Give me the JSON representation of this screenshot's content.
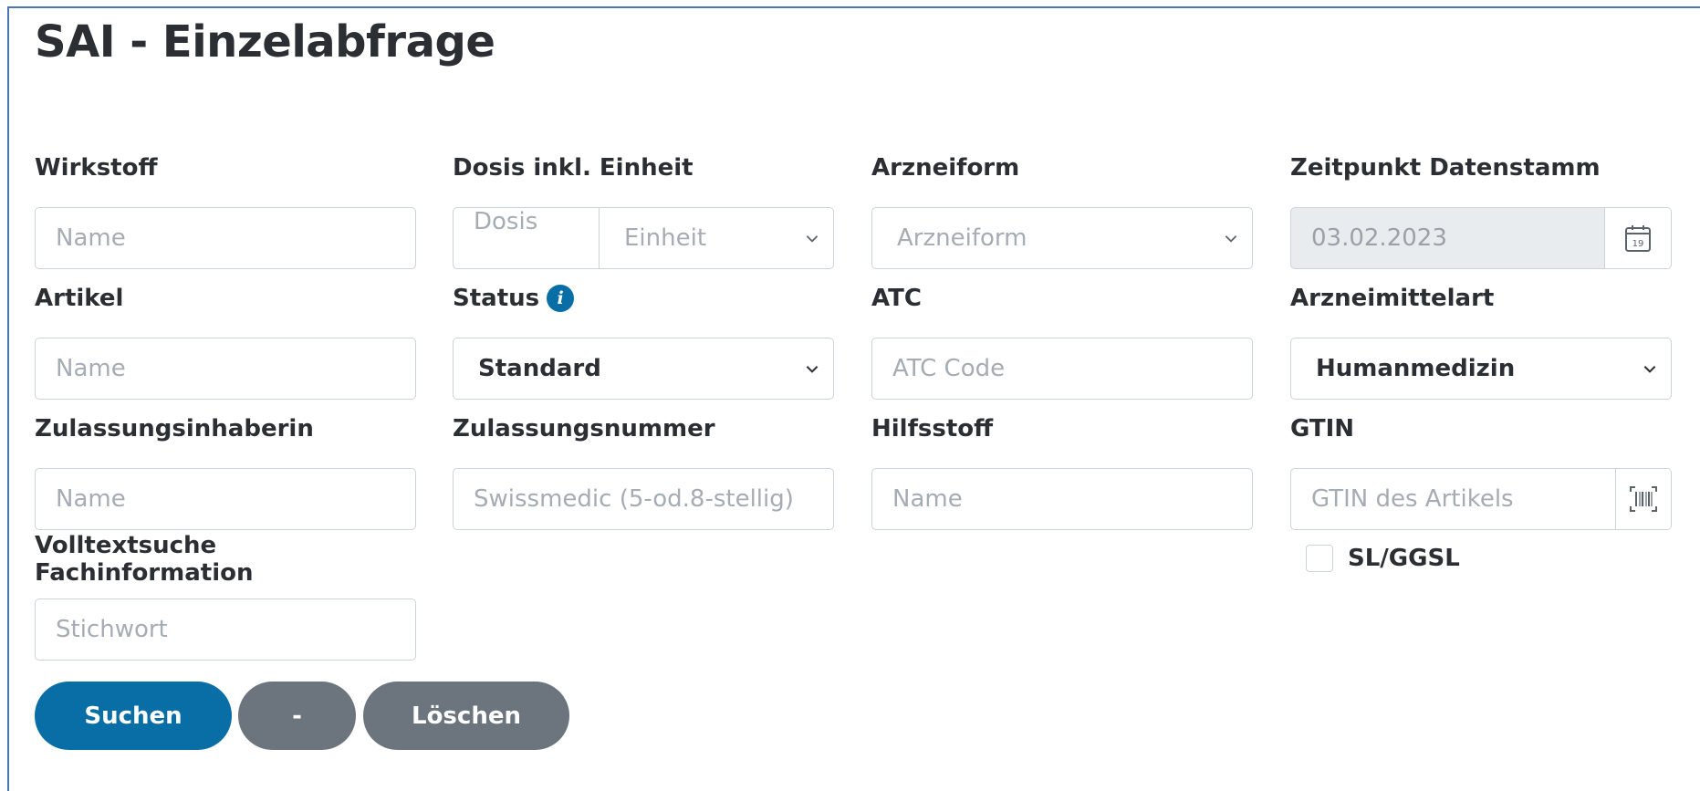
{
  "title": "SAI - Einzelabfrage",
  "fields": {
    "wirkstoff": {
      "label": "Wirkstoff",
      "placeholder": "Name",
      "value": ""
    },
    "dosis": {
      "label": "Dosis inkl. Einheit",
      "dosis_placeholder": "Dosis",
      "einheit_placeholder": "Einheit"
    },
    "arzneiform": {
      "label": "Arzneiform",
      "placeholder": "Arzneiform"
    },
    "zeitpunkt": {
      "label": "Zeitpunkt Datenstamm",
      "value": "03.02.2023",
      "calendar_day": "19"
    },
    "artikel": {
      "label": "Artikel",
      "placeholder": "Name",
      "value": ""
    },
    "status": {
      "label": "Status",
      "info": "i",
      "selected": "Standard"
    },
    "atc": {
      "label": "ATC",
      "placeholder": "ATC Code",
      "value": ""
    },
    "arzneimittelart": {
      "label": "Arzneimittelart",
      "selected": "Humanmedizin"
    },
    "zulassungsinhaberin": {
      "label": "Zulassungsinhaberin",
      "placeholder": "Name",
      "value": ""
    },
    "zulassungsnummer": {
      "label": "Zulassungsnummer",
      "placeholder": "Swissmedic (5-od.8-stellig)",
      "value": ""
    },
    "hilfsstoff": {
      "label": "Hilfsstoff",
      "placeholder": "Name",
      "value": ""
    },
    "gtin": {
      "label": "GTIN",
      "placeholder": "GTIN des Artikels",
      "value": ""
    },
    "volltext": {
      "label": "Volltextsuche Fachinformation",
      "placeholder": "Stichwort",
      "value": ""
    }
  },
  "checkbox": {
    "label": "SL/GGSL",
    "checked": false
  },
  "buttons": {
    "search": "Suchen",
    "minus": "-",
    "clear": "Löschen"
  },
  "colors": {
    "primary": "#0a6ea6",
    "secondary": "#6c757d",
    "frame": "#4a77b4",
    "disabled_bg": "#e9ecef"
  },
  "icons": {
    "calendar": "calendar-icon",
    "barcode": "barcode-icon",
    "info": "info-icon",
    "chevron": "chevron-down-icon"
  }
}
